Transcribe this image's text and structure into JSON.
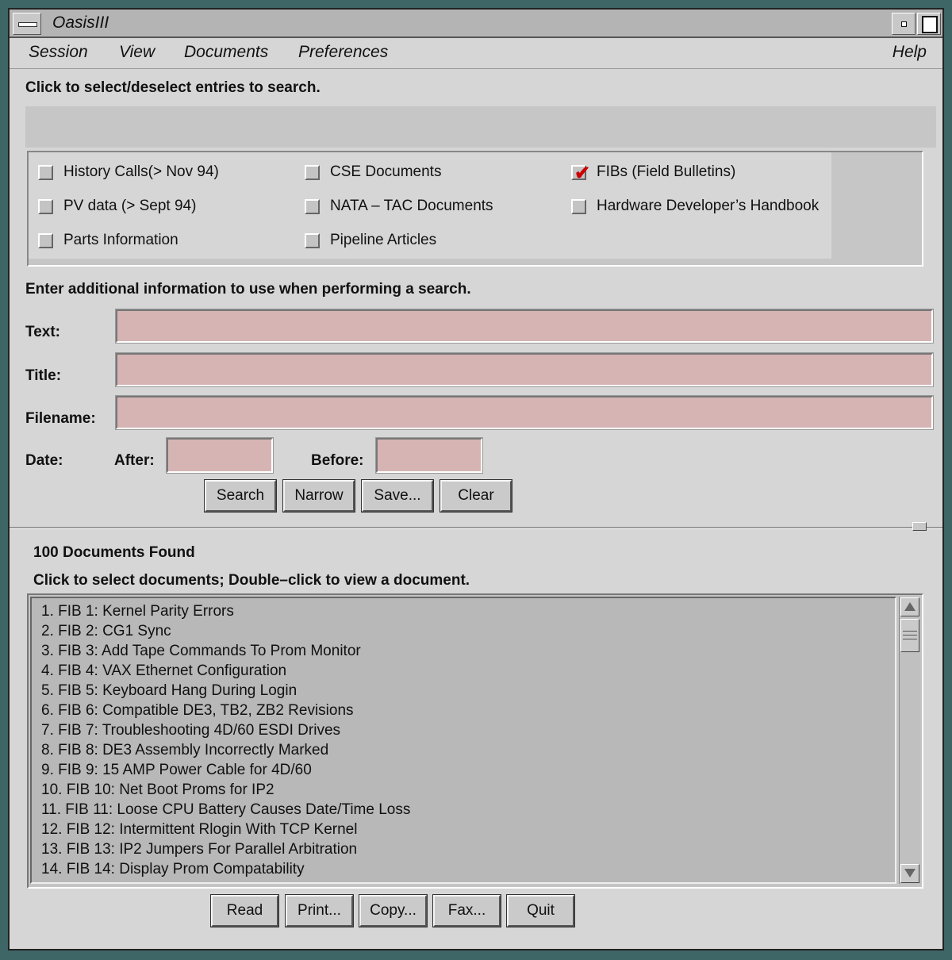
{
  "window": {
    "title": "OasisIII"
  },
  "menubar": {
    "items": [
      "Session",
      "View",
      "Documents",
      "Preferences"
    ],
    "help": "Help"
  },
  "selection": {
    "instruction": "Click to select/deselect entries to search.",
    "entries": [
      {
        "label": "History Calls(> Nov 94)",
        "checked": false
      },
      {
        "label": "PV data (> Sept 94)",
        "checked": false
      },
      {
        "label": "Parts Information",
        "checked": false
      },
      {
        "label": "CSE Documents",
        "checked": false
      },
      {
        "label": "NATA – TAC Documents",
        "checked": false
      },
      {
        "label": "Pipeline Articles",
        "checked": false
      },
      {
        "label": "FIBs (Field Bulletins)",
        "checked": true
      },
      {
        "label": "Hardware Developer’s Handbook",
        "checked": false
      }
    ]
  },
  "search": {
    "instruction": "Enter additional information to use when performing a search.",
    "text_label": "Text:",
    "text_value": "",
    "title_label": "Title:",
    "title_value": "",
    "filename_label": "Filename:",
    "filename_value": "",
    "date_label": "Date:",
    "after_label": "After:",
    "after_value": "",
    "before_label": "Before:",
    "before_value": "",
    "buttons": {
      "search": "Search",
      "narrow": "Narrow",
      "save": "Save...",
      "clear": "Clear"
    }
  },
  "results": {
    "count_text": "100 Documents Found",
    "instruction": "Click to select documents; Double–click to view a document.",
    "items": [
      "1.  FIB 1: Kernel Parity Errors",
      "2.  FIB 2: CG1 Sync",
      "3.  FIB 3: Add Tape Commands To Prom Monitor",
      "4.  FIB 4: VAX Ethernet Configuration",
      "5.  FIB 5: Keyboard Hang During Login",
      "6.  FIB 6: Compatible DE3, TB2, ZB2 Revisions",
      "7.  FIB 7: Troubleshooting 4D/60 ESDI Drives",
      "8.  FIB 8: DE3 Assembly Incorrectly Marked",
      "9.  FIB 9: 15 AMP Power Cable for 4D/60",
      "10.  FIB 10: Net Boot Proms for IP2",
      "11.  FIB 11: Loose CPU Battery Causes Date/Time Loss",
      "12.  FIB 12: Intermittent Rlogin With TCP Kernel",
      "13.  FIB 13: IP2 Jumpers For Parallel Arbitration",
      "14.  FIB 14: Display Prom Compatability"
    ],
    "buttons": {
      "read": "Read",
      "print": "Print...",
      "copy": "Copy...",
      "fax": "Fax...",
      "quit": "Quit"
    }
  },
  "colors": {
    "field_bg": "#d6b4b4",
    "checkmark": "#cc0000",
    "desktop": "#3e6666"
  }
}
